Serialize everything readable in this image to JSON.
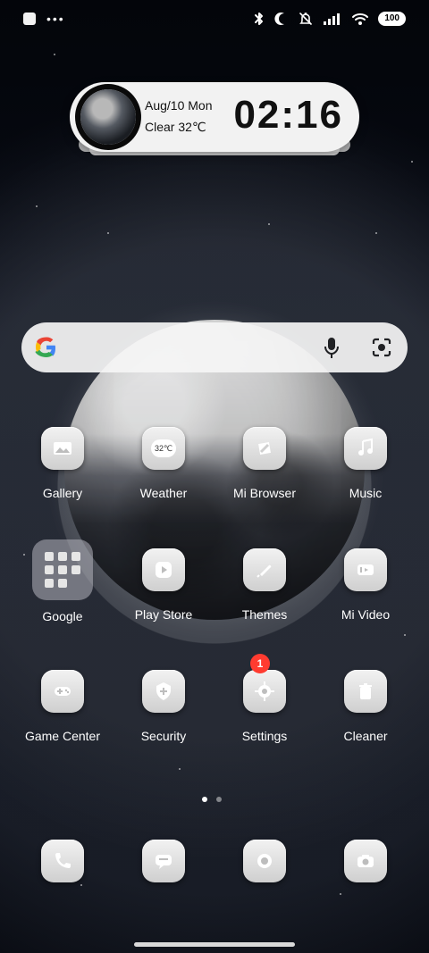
{
  "status_bar": {
    "battery": "100",
    "left_icons": [
      "notification-square-icon",
      "more-dots-icon"
    ],
    "right_icons": [
      "bluetooth-icon",
      "do-not-disturb-moon-icon",
      "bell-off-icon",
      "signal-icon",
      "wifi-icon",
      "battery-icon"
    ]
  },
  "clock_widget": {
    "date": "Aug/10 Mon",
    "weather": "Clear 32℃",
    "time": "02:16"
  },
  "search_bar": {
    "logo": "G",
    "mic_icon": "mic-icon",
    "lens_icon": "google-lens-icon"
  },
  "apps": [
    {
      "label": "Gallery",
      "icon": "gallery-icon"
    },
    {
      "label": "Weather",
      "icon": "weather-icon",
      "icon_text": "32℃"
    },
    {
      "label": "Mi Browser",
      "icon": "browser-icon"
    },
    {
      "label": "Music",
      "icon": "music-icon"
    },
    {
      "label": "Google",
      "icon": "folder-icon"
    },
    {
      "label": "Play Store",
      "icon": "play-store-icon"
    },
    {
      "label": "Themes",
      "icon": "themes-icon"
    },
    {
      "label": "Mi Video",
      "icon": "video-icon"
    },
    {
      "label": "Game Center",
      "icon": "game-controller-icon"
    },
    {
      "label": "Security",
      "icon": "security-shield-icon"
    },
    {
      "label": "Settings",
      "icon": "gear-icon",
      "badge": "1"
    },
    {
      "label": "Cleaner",
      "icon": "trash-icon"
    }
  ],
  "page_indicator": {
    "pages": 2,
    "active": 0
  },
  "dock": [
    {
      "icon": "phone-icon"
    },
    {
      "icon": "messages-icon"
    },
    {
      "icon": "camera-lens-icon"
    },
    {
      "icon": "camera-icon"
    }
  ],
  "colors": {
    "badge": "#ff3b30",
    "google_blue": "#4285F4",
    "google_red": "#EA4335",
    "google_yellow": "#FBBC05",
    "google_green": "#34A853"
  }
}
